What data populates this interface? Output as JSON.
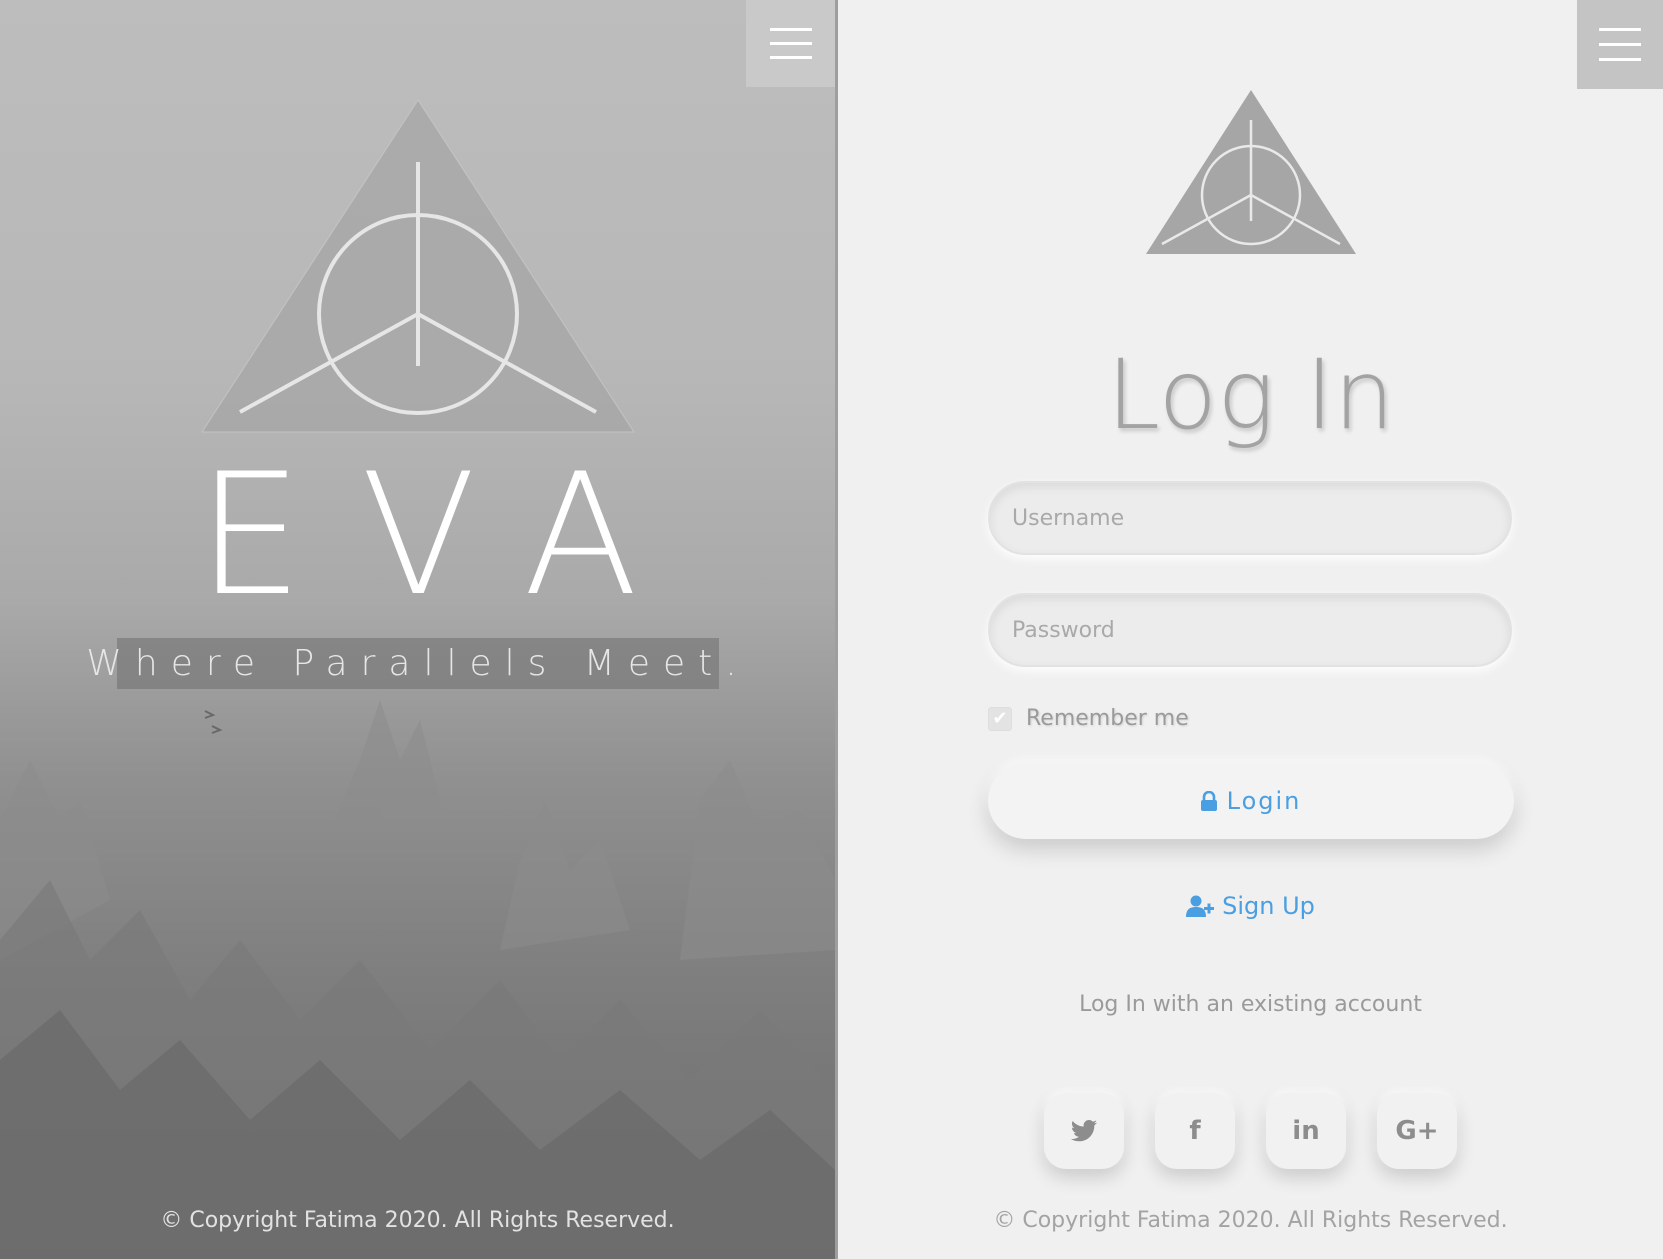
{
  "left_panel": {
    "brand": "EVA",
    "tagline": "Where Parallels Meet.",
    "copyright": "© Copyright Fatima 2020. All Rights Reserved.",
    "menu_icon": "hamburger-menu-icon",
    "logo_icon": "triangle-circle-logo-icon"
  },
  "right_panel": {
    "menu_icon": "hamburger-menu-icon",
    "logo_icon": "triangle-circle-logo-icon",
    "title": "Log In",
    "username": {
      "placeholder": "Username",
      "value": ""
    },
    "password": {
      "placeholder": "Password",
      "value": ""
    },
    "remember_label": "Remember me",
    "remember_checked": true,
    "login_label": "Login",
    "login_icon": "lock-icon",
    "signup_label": "Sign Up",
    "signup_icon": "user-plus-icon",
    "existing_account_text": "Log In with an existing account",
    "social_buttons": [
      {
        "icon": "twitter-icon",
        "glyph": "🐦"
      },
      {
        "icon": "facebook-icon",
        "glyph": "f"
      },
      {
        "icon": "linkedin-icon",
        "glyph": "in"
      },
      {
        "icon": "google-plus-icon",
        "glyph": "G+"
      }
    ],
    "copyright": "© Copyright Fatima 2020. All Rights Reserved."
  },
  "colors": {
    "accent": "#4a9fe2",
    "right_background": "#f0f0f0",
    "logo_gray": "#a6a6a6"
  }
}
